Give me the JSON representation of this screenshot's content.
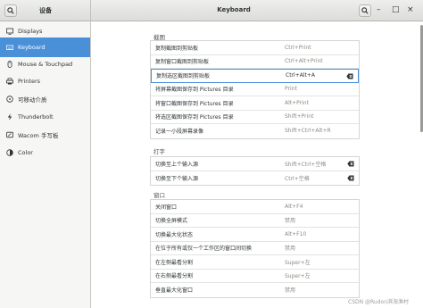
{
  "window": {
    "title": "Keyboard",
    "settings_title": "设备"
  },
  "window_controls": {
    "minimize": "–",
    "maximize": "□",
    "close": "×"
  },
  "sidebar": {
    "items": [
      {
        "label": "Displays",
        "icon": "display-icon",
        "active": false
      },
      {
        "label": "Keyboard",
        "icon": "keyboard-icon",
        "active": true
      },
      {
        "label": "Mouse & Touchpad",
        "icon": "mouse-icon",
        "active": false
      },
      {
        "label": "Printers",
        "icon": "printer-icon",
        "active": false
      },
      {
        "label": "可移动介质",
        "icon": "removable-media-icon",
        "active": false
      },
      {
        "label": "Thunderbolt",
        "icon": "thunderbolt-icon",
        "active": false
      },
      {
        "label": "Wacom 手写板",
        "icon": "wacom-icon",
        "active": false
      },
      {
        "label": "Color",
        "icon": "color-icon",
        "active": false
      }
    ]
  },
  "sections": [
    {
      "title": "截图",
      "rows": [
        {
          "name": "复制截图到剪贴板",
          "accel": "Ctrl+Print"
        },
        {
          "name": "复制窗口截图到剪贴板",
          "accel": "Ctrl+Alt+Print"
        },
        {
          "name": "复制选区截图到剪贴板",
          "accel": "Ctrl+Alt+A"
        },
        {
          "name": "将屏幕截图保存到 Pictures 目录",
          "accel": "Print"
        },
        {
          "name": "将窗口截图保存到 Pictures 目录",
          "accel": "Alt+Print"
        },
        {
          "name": "将选区截图保存到 Pictures 目录",
          "accel": "Shift+Print"
        },
        {
          "name": "记录一小段屏幕录像",
          "accel": "Shift+Ctrl+Alt+R"
        }
      ]
    },
    {
      "title": "打字",
      "rows": [
        {
          "name": "切换至上个输入源",
          "accel": "Shift+Ctrl+空格"
        },
        {
          "name": "切换至下个输入源",
          "accel": "Ctrl+空格"
        }
      ]
    },
    {
      "title": "窗口",
      "rows": [
        {
          "name": "关闭窗口",
          "accel": "Alt+F4"
        },
        {
          "name": "切换全屏模式",
          "accel": "禁用"
        },
        {
          "name": "切换最大化状态",
          "accel": "Alt+F10"
        },
        {
          "name": "在位于所有或仅一个工作区的窗口间切换",
          "accel": "禁用"
        },
        {
          "name": "在左侧最看分割",
          "accel": "Super+左"
        },
        {
          "name": "在右侧最看分割",
          "accel": "Super+左"
        },
        {
          "name": "垂直最大化窗口",
          "accel": "禁用"
        }
      ]
    }
  ],
  "watermark": "CSDN @Rudon滨海渔村"
}
